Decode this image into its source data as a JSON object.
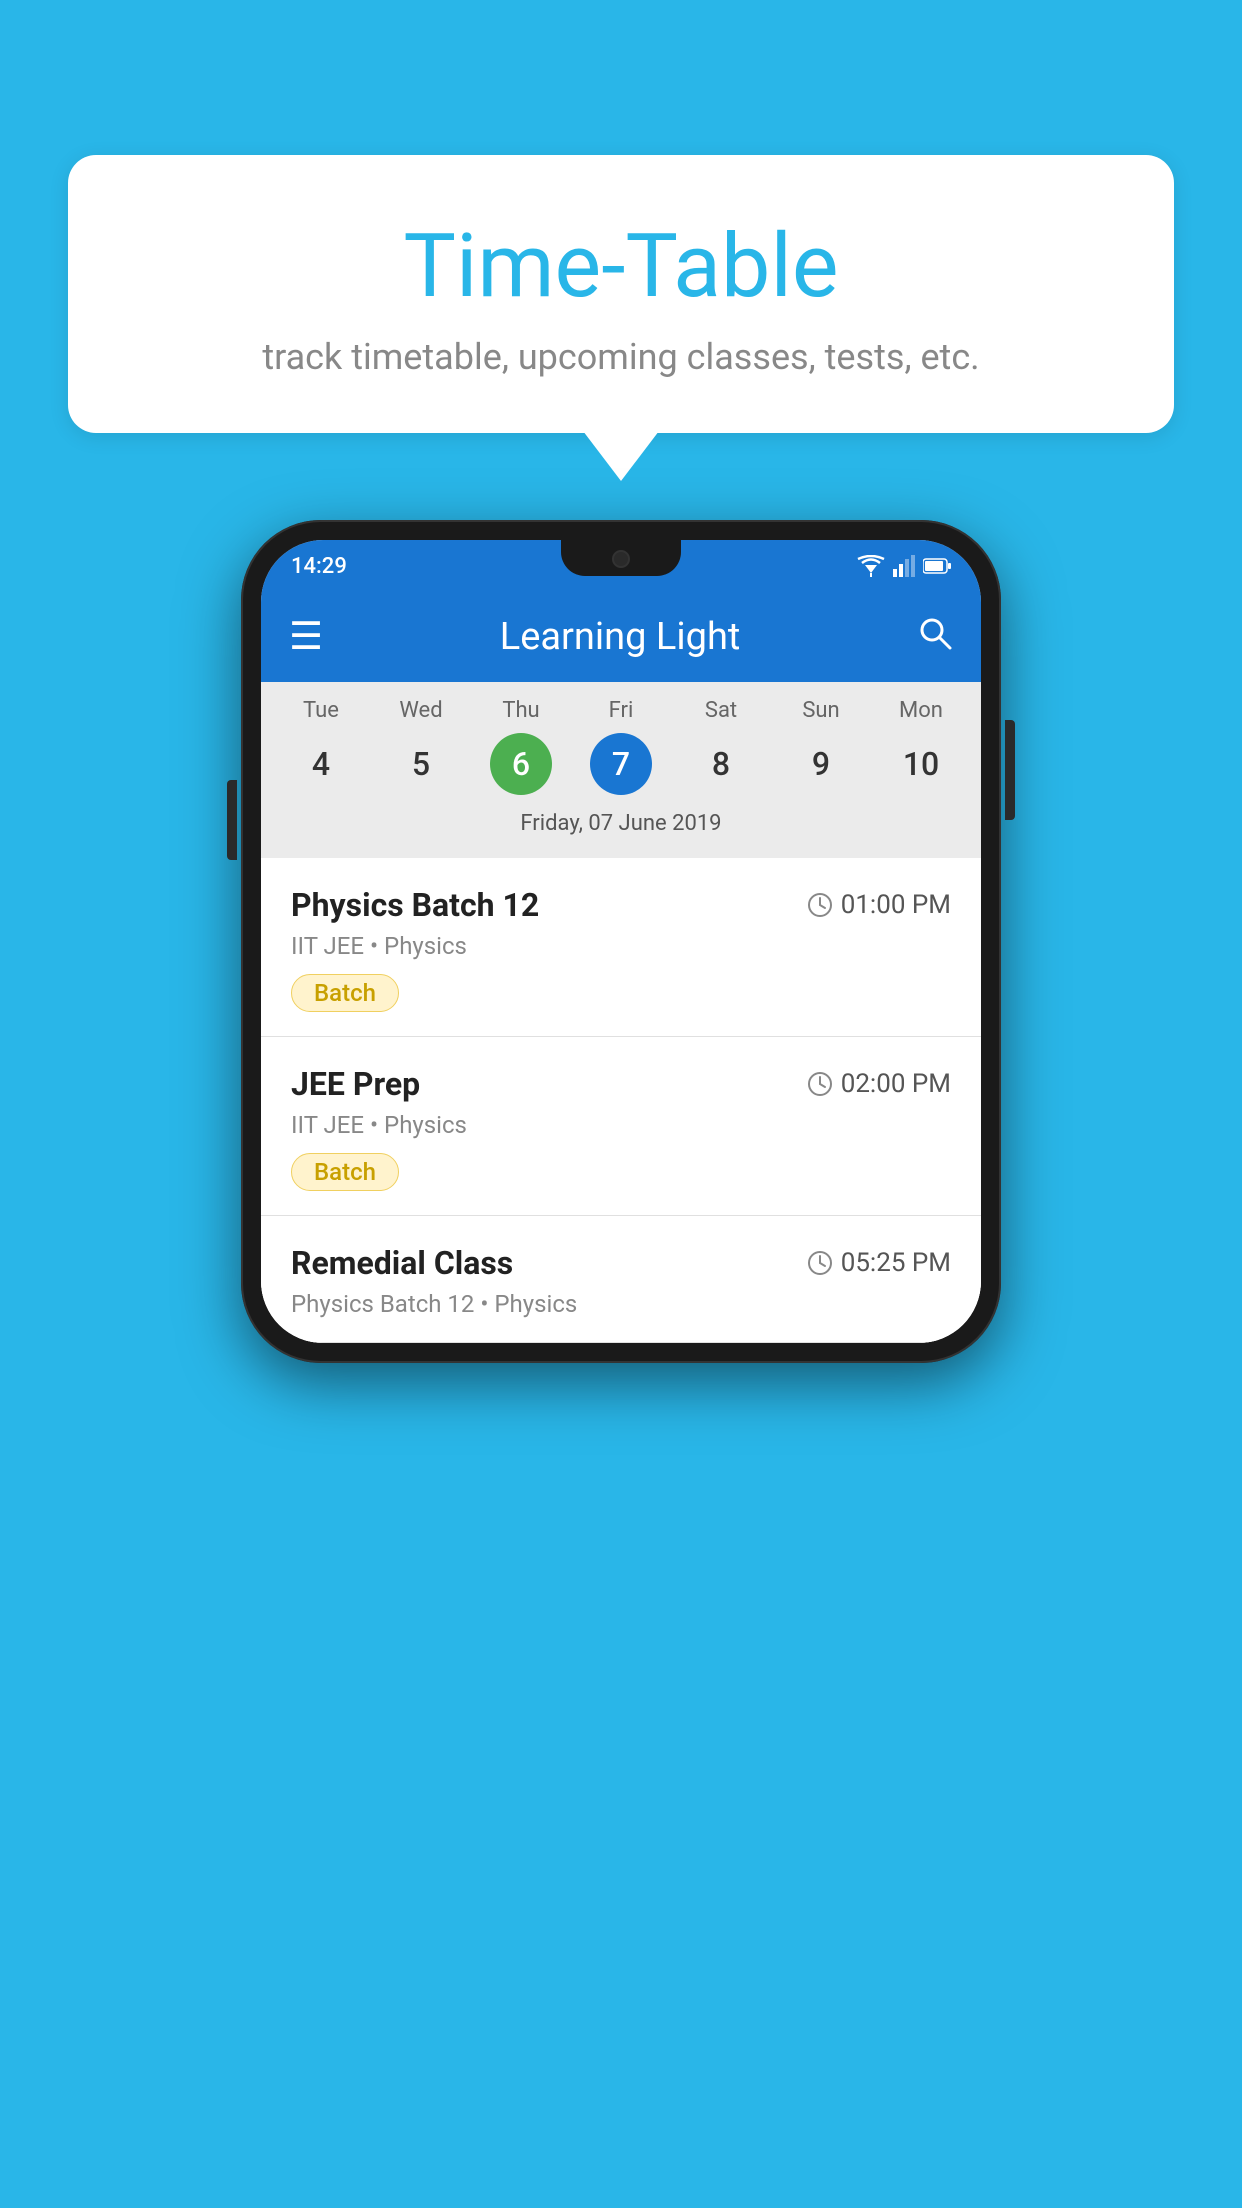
{
  "background_color": "#29b6e8",
  "bubble": {
    "title": "Time-Table",
    "subtitle": "track timetable, upcoming classes, tests, etc."
  },
  "status_bar": {
    "time": "14:29"
  },
  "app_bar": {
    "title": "Learning Light",
    "menu_icon": "≡",
    "search_icon": "🔍"
  },
  "calendar": {
    "days": [
      {
        "name": "Tue",
        "number": "4",
        "state": "normal"
      },
      {
        "name": "Wed",
        "number": "5",
        "state": "normal"
      },
      {
        "name": "Thu",
        "number": "6",
        "state": "today"
      },
      {
        "name": "Fri",
        "number": "7",
        "state": "selected"
      },
      {
        "name": "Sat",
        "number": "8",
        "state": "normal"
      },
      {
        "name": "Sun",
        "number": "9",
        "state": "normal"
      },
      {
        "name": "Mon",
        "number": "10",
        "state": "normal"
      }
    ],
    "selected_date_label": "Friday, 07 June 2019"
  },
  "schedule": {
    "items": [
      {
        "title": "Physics Batch 12",
        "time": "01:00 PM",
        "subtitle": "IIT JEE • Physics",
        "tag": "Batch"
      },
      {
        "title": "JEE Prep",
        "time": "02:00 PM",
        "subtitle": "IIT JEE • Physics",
        "tag": "Batch"
      },
      {
        "title": "Remedial Class",
        "time": "05:25 PM",
        "subtitle": "Physics Batch 12 • Physics",
        "tag": null
      }
    ]
  }
}
